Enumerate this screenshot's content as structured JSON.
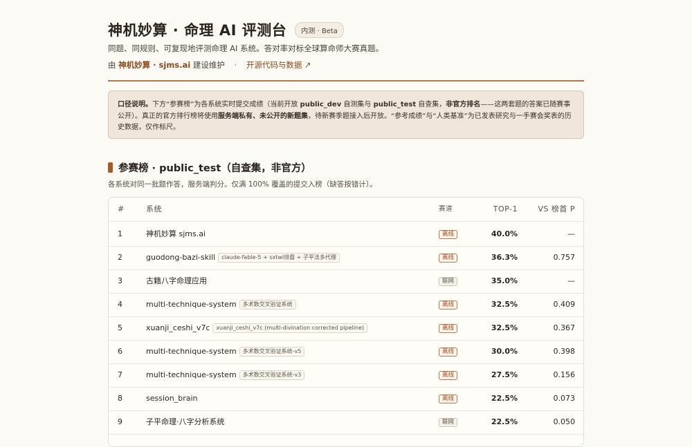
{
  "header": {
    "title": "神机妙算 · 命理 AI 评测台",
    "badge": "内测 · Beta",
    "subtitle": "同题、同规则、可复现地评测命理 AI 系统。答对率对标全球算命师大赛真题。",
    "maint_prefix": "由",
    "maint_link": "神机妙算 · sjms.ai",
    "maint_suffix": "建设维护",
    "sep": "·",
    "open_source": "开源代码与数据 ↗"
  },
  "notice": {
    "p1_bold": "口径说明。",
    "p1": "下方“参赛榜”为各系统实时提交成绩（当前开放 ",
    "p2_bold": "public_dev",
    "p2": " 自测集与 ",
    "p3_bold": "public_test",
    "p3": " 自查集，",
    "p4_bold": "非官方排名",
    "p4": "——这两套题的答案已随赛事公开）。真正的官方排行榜将使用",
    "p5_bold": "服务端私有、未公开的新题集",
    "p5": "，待新赛季题接入后开放。“参考成绩”与“人类基准”为已发表研究与一手赛会奖表的历史数据，仅作标尺。"
  },
  "section": {
    "title": "参赛榜 · public_test（自查集，非官方）",
    "desc": "各系统对同一批题作答，服务端判分。仅满 100% 覆盖的提交入榜（缺答按错计）。"
  },
  "table": {
    "headers": {
      "rank": "#",
      "system": "系统",
      "track": "赛道",
      "top1": "TOP-1",
      "vs": "VS 榜首 P"
    },
    "rows": [
      {
        "rank": "1",
        "name": "神机妙算 sjms.ai",
        "tag": "",
        "track": "离线",
        "offline": true,
        "top1": "40.0%",
        "vs": "—"
      },
      {
        "rank": "2",
        "name": "guodong-bazi-skill",
        "tag": "claude-fable-5 + sxtwl排盘 + 子平法多代理",
        "track": "离线",
        "offline": true,
        "top1": "36.3%",
        "vs": "0.757"
      },
      {
        "rank": "3",
        "name": "古籍八字命理应用",
        "tag": "",
        "track": "联网",
        "offline": false,
        "top1": "35.0%",
        "vs": "—"
      },
      {
        "rank": "4",
        "name": "multi-technique-system",
        "tag": "多术数交叉验证系统",
        "track": "离线",
        "offline": true,
        "top1": "32.5%",
        "vs": "0.409"
      },
      {
        "rank": "5",
        "name": "xuanji_ceshi_v7c",
        "tag": "xuanji_ceshi_v7c (multi-divination corrected pipeline)",
        "track": "离线",
        "offline": true,
        "top1": "32.5%",
        "vs": "0.367"
      },
      {
        "rank": "6",
        "name": "multi-technique-system",
        "tag": "多术数交叉验证系统-v5",
        "track": "离线",
        "offline": true,
        "top1": "30.0%",
        "vs": "0.398"
      },
      {
        "rank": "7",
        "name": "multi-technique-system",
        "tag": "多术数交叉验证系统-v3",
        "track": "离线",
        "offline": true,
        "top1": "27.5%",
        "vs": "0.156"
      },
      {
        "rank": "8",
        "name": "session_brain",
        "tag": "",
        "track": "离线",
        "offline": true,
        "top1": "22.5%",
        "vs": "0.073"
      },
      {
        "rank": "9",
        "name": "子平命理·八字分析系统",
        "tag": "",
        "track": "联网",
        "offline": false,
        "top1": "22.5%",
        "vs": "0.050"
      }
    ]
  }
}
